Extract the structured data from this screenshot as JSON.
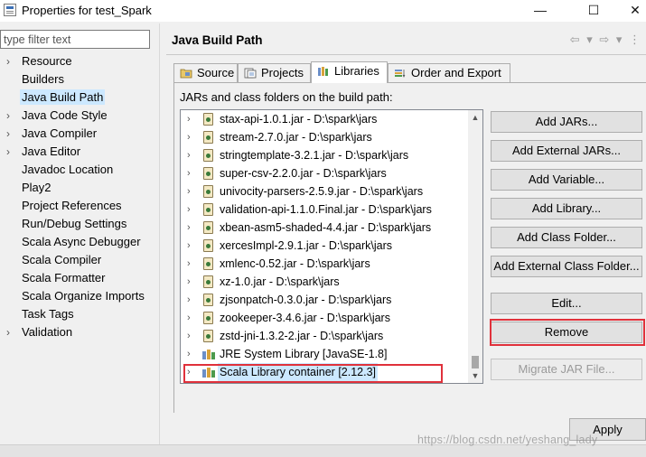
{
  "window": {
    "title": "Properties for test_Spark",
    "minimize_glyph": "—",
    "maximize_glyph": "☐",
    "close_glyph": "✕"
  },
  "filter": {
    "placeholder": "type filter text",
    "value": ""
  },
  "nav": {
    "items": [
      {
        "label": "Resource",
        "expandable": true
      },
      {
        "label": "Builders",
        "expandable": false
      },
      {
        "label": "Java Build Path",
        "expandable": false,
        "selected": true
      },
      {
        "label": "Java Code Style",
        "expandable": true
      },
      {
        "label": "Java Compiler",
        "expandable": true
      },
      {
        "label": "Java Editor",
        "expandable": true
      },
      {
        "label": "Javadoc Location",
        "expandable": false
      },
      {
        "label": "Play2",
        "expandable": false
      },
      {
        "label": "Project References",
        "expandable": false
      },
      {
        "label": "Run/Debug Settings",
        "expandable": false
      },
      {
        "label": "Scala Async Debugger",
        "expandable": false
      },
      {
        "label": "Scala Compiler",
        "expandable": false
      },
      {
        "label": "Scala Formatter",
        "expandable": false
      },
      {
        "label": "Scala Organize Imports",
        "expandable": false
      },
      {
        "label": "Task Tags",
        "expandable": false
      },
      {
        "label": "Validation",
        "expandable": true
      }
    ]
  },
  "page": {
    "title": "Java Build Path",
    "nav_arrows": "⇦ ▾ ⇨ ▾ ⋮"
  },
  "tabs": [
    {
      "label": "Source",
      "icon": "source-folder-icon"
    },
    {
      "label": "Projects",
      "icon": "projects-icon"
    },
    {
      "label": "Libraries",
      "icon": "libraries-icon",
      "active": true
    },
    {
      "label": "Order and Export",
      "icon": "order-export-icon"
    }
  ],
  "libraries": {
    "caption": "JARs and class folders on the build path:",
    "entries": [
      {
        "text": "stax-api-1.0.1.jar - D:\\spark\\jars",
        "icon": "jar-icon"
      },
      {
        "text": "stream-2.7.0.jar - D:\\spark\\jars",
        "icon": "jar-icon"
      },
      {
        "text": "stringtemplate-3.2.1.jar - D:\\spark\\jars",
        "icon": "jar-icon"
      },
      {
        "text": "super-csv-2.2.0.jar - D:\\spark\\jars",
        "icon": "jar-icon"
      },
      {
        "text": "univocity-parsers-2.5.9.jar - D:\\spark\\jars",
        "icon": "jar-icon"
      },
      {
        "text": "validation-api-1.1.0.Final.jar - D:\\spark\\jars",
        "icon": "jar-icon"
      },
      {
        "text": "xbean-asm5-shaded-4.4.jar - D:\\spark\\jars",
        "icon": "jar-icon"
      },
      {
        "text": "xercesImpl-2.9.1.jar - D:\\spark\\jars",
        "icon": "jar-icon"
      },
      {
        "text": "xmlenc-0.52.jar - D:\\spark\\jars",
        "icon": "jar-icon"
      },
      {
        "text": "xz-1.0.jar - D:\\spark\\jars",
        "icon": "jar-icon"
      },
      {
        "text": "zjsonpatch-0.3.0.jar - D:\\spark\\jars",
        "icon": "jar-icon"
      },
      {
        "text": "zookeeper-3.4.6.jar - D:\\spark\\jars",
        "icon": "jar-icon"
      },
      {
        "text": "zstd-jni-1.3.2-2.jar - D:\\spark\\jars",
        "icon": "jar-icon"
      },
      {
        "text": "JRE System Library [JavaSE-1.8]",
        "icon": "library-icon"
      },
      {
        "text": "Scala Library container [2.12.3]",
        "icon": "library-icon",
        "selected": true
      }
    ]
  },
  "buttons": {
    "add_jars": "Add JARs...",
    "add_external_jars": "Add External JARs...",
    "add_variable": "Add Variable...",
    "add_library": "Add Library...",
    "add_class_folder": "Add Class Folder...",
    "add_external_class_folder": "Add External Class Folder...",
    "edit": "Edit...",
    "remove": "Remove",
    "migrate_jar_file": "Migrate JAR File...",
    "apply": "Apply"
  },
  "watermark": "https://blog.csdn.net/yeshang_lady",
  "colors": {
    "highlight_red": "#e0313b",
    "selection_blue": "#cce8ff"
  }
}
